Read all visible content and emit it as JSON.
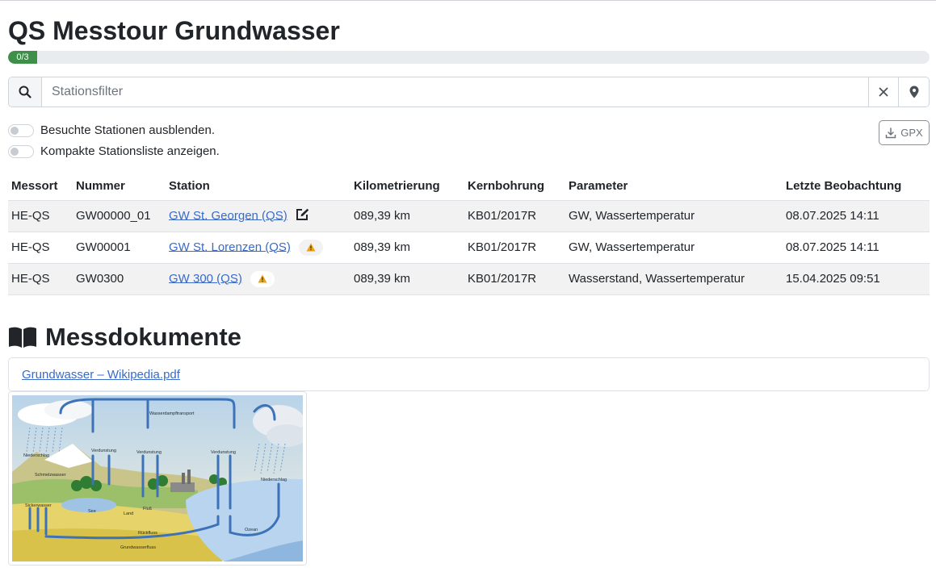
{
  "page": {
    "title": "QS Messtour Grundwasser",
    "progress_label": "0/3",
    "progress_fraction": 0
  },
  "search": {
    "placeholder": "Stationsfilter",
    "value": ""
  },
  "toggles": [
    {
      "label": "Besuchte Stationen ausblenden.",
      "on": false
    },
    {
      "label": "Kompakte Stationsliste anzeigen.",
      "on": false
    }
  ],
  "gpx_button": {
    "label": "GPX"
  },
  "table": {
    "headers": [
      "Messort",
      "Nummer",
      "Station",
      "Kilometrierung",
      "Kernbohrung",
      "Parameter",
      "Letzte Beobachtung"
    ],
    "rows": [
      {
        "messort": "HE-QS",
        "nummer": "GW00000_01",
        "station": "GW St. Georgen (QS)",
        "km": "089,39 km",
        "kern": "KB01/2017R",
        "parameter": "GW, Wassertemperatur",
        "letzte": "08.07.2025 14:11",
        "icon": "edit-icon"
      },
      {
        "messort": "HE-QS",
        "nummer": "GW00001",
        "station": "GW St. Lorenzen (QS)",
        "km": "089,39 km",
        "kern": "KB01/2017R",
        "parameter": "GW, Wassertemperatur",
        "letzte": "08.07.2025 14:11",
        "icon": "warning-icon"
      },
      {
        "messort": "HE-QS",
        "nummer": "GW0300",
        "station": "GW 300 (QS)",
        "km": "089,39 km",
        "kern": "KB01/2017R",
        "parameter": "Wasserstand, Wassertemperatur",
        "letzte": "15.04.2025 09:51",
        "icon": "warning-icon"
      }
    ]
  },
  "documents": {
    "heading": "Messdokumente",
    "icon": "book-icon",
    "file_link": "Grundwasser – Wikipedia.pdf",
    "diagram_labels": {
      "transport": "Wasserdampftransport",
      "niederschlag_left": "Niederschlag",
      "niederschlag_right": "Niederschlag",
      "verdunstung_1": "Verdunstung",
      "verdunstung_2": "Verdunstung",
      "verdunstung_3": "Verdunstung",
      "schmelzwasser": "Schmelzwasser",
      "sickerwasser": "Sickerwasser",
      "see": "See",
      "land": "Land",
      "fluss": "Fluß",
      "ozean": "Ozean",
      "rueckfluss": "Rückfluss",
      "grundwasserfluss": "Grundwasserfluss"
    }
  },
  "colors": {
    "progress": "#3d8f4a",
    "link": "#3a6bc8",
    "row_stripe": "#f2f2f2"
  }
}
